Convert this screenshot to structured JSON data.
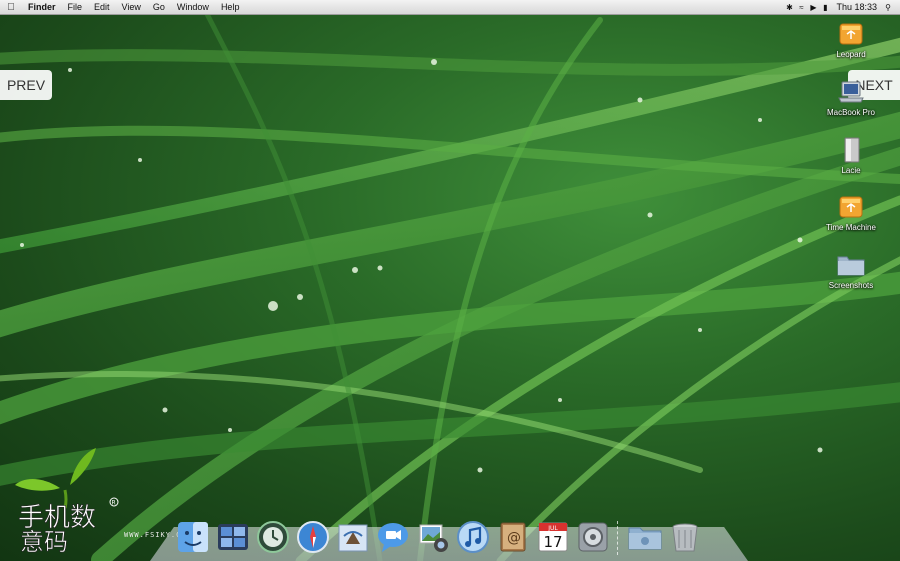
{
  "menubar": {
    "app_name": "Finder",
    "menus": [
      "File",
      "Edit",
      "View",
      "Go",
      "Window",
      "Help"
    ],
    "clock": "Thu 18:33"
  },
  "navigation": {
    "prev_label": "PREV",
    "next_label": "NEXT"
  },
  "desktop_icons": [
    {
      "label": "Leopard",
      "icon": "external-drive-orange-icon"
    },
    {
      "label": "MacBook Pro",
      "icon": "laptop-drive-icon"
    },
    {
      "label": "Lacie",
      "icon": "external-drive-gray-icon"
    },
    {
      "label": "Time Machine",
      "icon": "external-drive-orange-icon"
    },
    {
      "label": "Screenshots",
      "icon": "folder-icon"
    }
  ],
  "logo": {
    "url_text": "WWW.FSIKY.COM"
  },
  "dock": [
    {
      "name": "finder",
      "icon": "finder-icon"
    },
    {
      "name": "dashboard",
      "icon": "dashboard-icon"
    },
    {
      "name": "time-machine",
      "icon": "time-machine-icon"
    },
    {
      "name": "safari",
      "icon": "safari-icon"
    },
    {
      "name": "mail",
      "icon": "mail-icon"
    },
    {
      "name": "ichat",
      "icon": "ichat-icon"
    },
    {
      "name": "iphoto",
      "icon": "iphoto-icon"
    },
    {
      "name": "itunes",
      "icon": "itunes-icon"
    },
    {
      "name": "address-book",
      "icon": "address-book-icon"
    },
    {
      "name": "ical",
      "icon": "calendar-icon",
      "day": "17",
      "month": "JUL"
    },
    {
      "name": "system-preferences",
      "icon": "system-preferences-icon"
    },
    {
      "name": "documents-stack",
      "icon": "folder-stack-icon"
    },
    {
      "name": "trash",
      "icon": "trash-icon"
    }
  ]
}
